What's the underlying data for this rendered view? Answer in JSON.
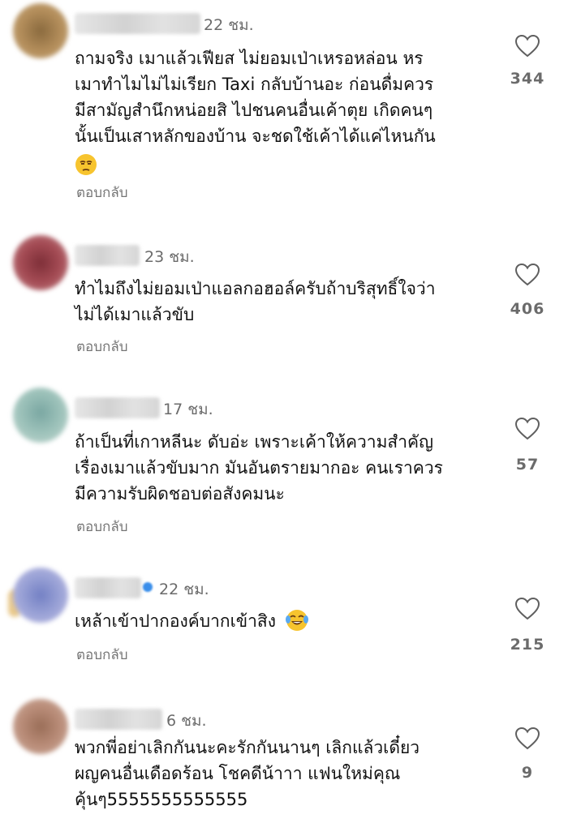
{
  "reply_label": "ตอบกลับ",
  "icons": {
    "like": "heart-outline-icon",
    "unamused": "unamused-face-emoji-icon",
    "joy": "face-with-tears-of-joy-emoji-icon"
  },
  "colors": {
    "text": "#111111",
    "muted": "#6b6b6b",
    "verified": "#3a8eea"
  },
  "comments": [
    {
      "time": "22 ชม.",
      "lines": [
        "ถามจริง เมาแล้วเฟียส ไม่ยอมเป่าเหรอหล่อน หร",
        "เมาทำไมไม่ไม่เรียก Taxi กลับบ้านอะ ก่อนดื่มควร",
        "มีสามัญสำนึกหน่อยสิ ไปชนคนอื่นเค้าตุย เกิดคนๆ",
        "นั้นเป็นเสาหลักของบ้าน จะชดใช้เค้าได้แค่ไหนกัน"
      ],
      "likes": "344"
    },
    {
      "time": "23 ชม.",
      "lines": [
        "ทำไมถึงไม่ยอมเป่าแอลกอฮอล์ครับถ้าบริสุทธิ์ใจว่า",
        "ไม่ได้เมาแล้วขับ"
      ],
      "likes": "406"
    },
    {
      "time": "17 ชม.",
      "lines": [
        "ถ้าเป็นที่เกาหลีนะ ดับอ่ะ เพราะเค้าให้ความสำคัญ",
        "เรื่องเมาแล้วขับมาก มันอันตรายมากอะ คนเราควร",
        "มีความรับผิดชอบต่อสังคมนะ"
      ],
      "likes": "57"
    },
    {
      "time": "22 ชม.",
      "lines": [
        "เหล้าเข้าปากองค์บากเข้าสิง"
      ],
      "likes": "215"
    },
    {
      "time": "6 ชม.",
      "lines": [
        "พวกพี่อย่าเลิกกันนะคะรักกันนานๆ เลิกแล้วเดี๋ยว",
        "ผญคนอื่นเดือดร้อน โชคดีน้าาา แฟนใหม่คุณ",
        "คุ้นๆ5555555555555"
      ],
      "likes": "9"
    }
  ]
}
